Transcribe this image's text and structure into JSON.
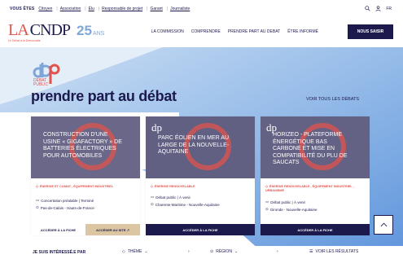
{
  "topbar": {
    "you_are": "VOUS ÊTES",
    "links": [
      "Citoyen",
      "Association",
      "Élu",
      "Responsable de projet",
      "Garant",
      "Journaliste"
    ],
    "lang": "FR"
  },
  "header": {
    "logo_la": "LA",
    "logo_cndp": "CNDP",
    "anniversary": "25",
    "anniversary_suffix": "ANS",
    "tagline": "Le Débat à la Démocratie",
    "nav": [
      "LA COMMISSION",
      "COMPRENDRE",
      "PRENDRE PART AU DEBAT",
      "ÊTRE INFORMÉ"
    ],
    "cta": "NOUS SAISIR"
  },
  "hero": {
    "logo_sub_1": "DÉBAT",
    "logo_sub_2": "PUBLIC",
    "headline": "prendre part au débat",
    "see_all": "VOIR TOUS LES DÉBATS"
  },
  "cards": [
    {
      "title": "CONSTRUCTION D'UNE USINE « GIGAFACTORY » DE BATTERIES ÉLECTRIQUES POUR AUTOMOBILES",
      "dp": "",
      "tag": "ÉNERGIE ET CLIMAT , ÉQUIPEMENT INDUSTRIEL",
      "status": "Concertation préalable | Terminé",
      "location": "Pas-de-Calais - Hauts-de-France",
      "btn1": "ACCÉDER À LA FICHE",
      "btn2": "ACCÉDER AU SITE ↗"
    },
    {
      "title": "PARC ÉOLIEN EN MER AU LARGE DE LA NOUVELLE-AQUITAINE",
      "dp": "dp",
      "tag": "ÉNERGIE RENOUVELABLE",
      "status": "Débat public | À venir",
      "location": "Charente-Maritime - Nouvelle-Aquitaine",
      "btn1": "ACCÉDER À LA FICHE",
      "btn2": ""
    },
    {
      "title": "HORIZEO - PLATEFORME ÉNERGÉTIQUE BAS CARBONE ET MISE EN COMPATIBILITÉ DU PLU DE SAUCATS",
      "dp": "dp",
      "tag": "ÉNERGIE RENOUVELABLE , ÉQUIPEMENT INDUSTRIEL , URBANISME",
      "status": "Débat public | À venir",
      "location": "Gironde - Nouvelle-Aquitaine",
      "btn1": "ACCÉDER À LA FICHE",
      "btn2": ""
    }
  ],
  "filter": {
    "label": "JE SUIS INTÉRESSÉ.E PAR",
    "theme": "THÈME",
    "region": "RÉGION",
    "results": "VOIR LES RÉSULTATS"
  },
  "colors": {
    "navy": "#1c1a4d",
    "coral": "#e2534c",
    "sky": "#7ea7d8",
    "beige": "#dcc5a1"
  }
}
